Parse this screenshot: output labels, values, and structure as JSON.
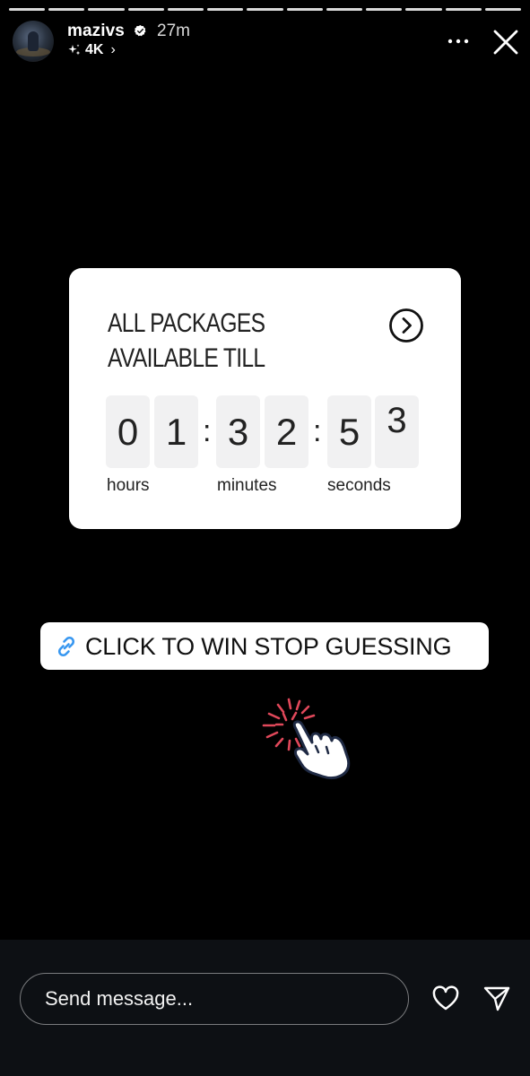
{
  "header": {
    "username": "mazivs",
    "time_ago": "27m",
    "quality": "4K",
    "quality_chevron": "›",
    "icons": [
      "verified-badge-icon",
      "sparkle-icon",
      "more-icon",
      "close-icon"
    ]
  },
  "progress_segments": 13,
  "countdown": {
    "title_line1": "ALL PACKAGES",
    "title_line2": "AVAILABLE TILL",
    "digits": [
      "0",
      "1",
      "3",
      "2",
      "5",
      "3"
    ],
    "separator": ":",
    "units": {
      "hours": "hours",
      "minutes": "minutes",
      "seconds": "seconds"
    }
  },
  "link_sticker": {
    "label": "CLICK TO WIN STOP GUESSING",
    "icon": "link-icon"
  },
  "bottom_bar": {
    "message_placeholder": "Send message...",
    "icons": [
      "heart-icon",
      "send-icon"
    ]
  },
  "colors": {
    "background": "#000000",
    "card": "#ffffff",
    "digit_tile": "#f1f1f2",
    "link_icon": "#3897f0",
    "hand_burst": "#e0485a",
    "bottom_bar": "#0d1014"
  }
}
